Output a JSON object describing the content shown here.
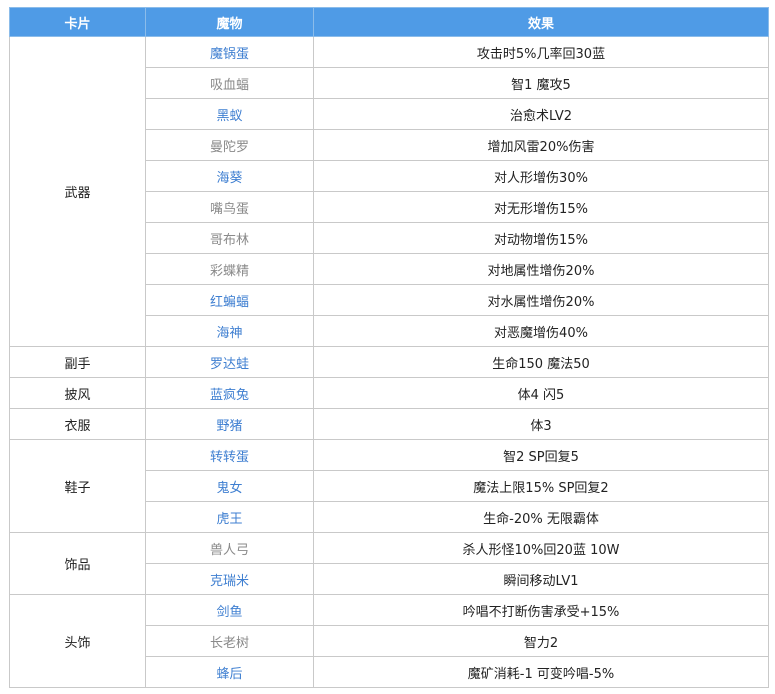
{
  "headers": {
    "card": "卡片",
    "monster": "魔物",
    "effect": "效果"
  },
  "groups": [
    {
      "card": "武器",
      "rows": [
        {
          "monster": "魔锅蛋",
          "effect": "攻击时5%几率回30蓝",
          "link": true
        },
        {
          "monster": "吸血蝠",
          "effect": "智1 魔攻5",
          "link": false
        },
        {
          "monster": "黑蚁",
          "effect": "治愈术LV2",
          "link": true
        },
        {
          "monster": "曼陀罗",
          "effect": "增加风雷20%伤害",
          "link": false
        },
        {
          "monster": "海葵",
          "effect": "对人形增伤30%",
          "link": true
        },
        {
          "monster": "嘴鸟蛋",
          "effect": "对无形增伤15%",
          "link": false
        },
        {
          "monster": "哥布林",
          "effect": "对动物增伤15%",
          "link": false
        },
        {
          "monster": "彩蝶精",
          "effect": "对地属性增伤20%",
          "link": false
        },
        {
          "monster": "红蝙蝠",
          "effect": "对水属性增伤20%",
          "link": true
        },
        {
          "monster": "海神",
          "effect": "对恶魔增伤40%",
          "link": true
        }
      ]
    },
    {
      "card": "副手",
      "rows": [
        {
          "monster": "罗达蛙",
          "effect": "生命150 魔法50",
          "link": true
        }
      ]
    },
    {
      "card": "披风",
      "rows": [
        {
          "monster": "蓝疯兔",
          "effect": "体4 闪5",
          "link": true
        }
      ]
    },
    {
      "card": "衣服",
      "rows": [
        {
          "monster": "野猪",
          "effect": "体3",
          "link": true
        }
      ]
    },
    {
      "card": "鞋子",
      "rows": [
        {
          "monster": "转转蛋",
          "effect": "智2 SP回复5",
          "link": true
        },
        {
          "monster": "鬼女",
          "effect": "魔法上限15% SP回复2",
          "link": true
        },
        {
          "monster": "虎王",
          "effect": "生命-20% 无限霸体",
          "link": true
        }
      ]
    },
    {
      "card": "饰品",
      "rows": [
        {
          "monster": "兽人弓",
          "effect": "杀人形怪10%回20蓝 10W",
          "link": false
        },
        {
          "monster": "克瑞米",
          "effect": "瞬间移动LV1",
          "link": true
        }
      ]
    },
    {
      "card": "头饰",
      "rows": [
        {
          "monster": "剑鱼",
          "effect": "吟唱不打断伤害承受+15%",
          "link": true
        },
        {
          "monster": "长老树",
          "effect": "智力2",
          "link": false
        },
        {
          "monster": "蜂后",
          "effect": "魔矿消耗-1 可变吟唱-5%",
          "link": true
        }
      ]
    }
  ]
}
